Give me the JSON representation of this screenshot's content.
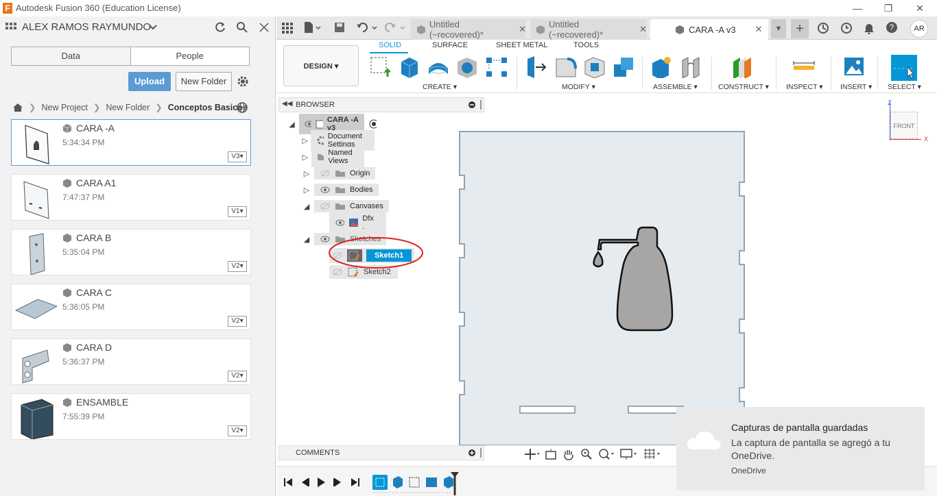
{
  "window": {
    "title": "Autodesk Fusion 360 (Education License)"
  },
  "left_panel": {
    "user": "ALEX RAMOS RAYMUNDO",
    "tabs": [
      "Data",
      "People"
    ],
    "upload_label": "Upload",
    "new_folder_label": "New Folder",
    "breadcrumb": [
      "New Project",
      "New Folder",
      "Conceptos Basicos"
    ],
    "files": [
      {
        "name": "CARA -A",
        "time": "5:34:34 PM",
        "version": "V3"
      },
      {
        "name": "CARA A1",
        "time": "7:47:37 PM",
        "version": "V1"
      },
      {
        "name": "CARA B",
        "time": "5:35:04 PM",
        "version": "V2"
      },
      {
        "name": "CARA C",
        "time": "5:36:05 PM",
        "version": "V2"
      },
      {
        "name": "CARA D",
        "time": "5:36:37 PM",
        "version": "V2"
      },
      {
        "name": "ENSAMBLE",
        "time": "7:55:39 PM",
        "version": "V2"
      }
    ]
  },
  "doc_tabs": [
    {
      "label": "Untitled (~recovered)*"
    },
    {
      "label": "Untitled (~recovered)*"
    },
    {
      "label": "CARA -A v3"
    }
  ],
  "user_initials": "AR",
  "toolbar": {
    "workspace": "DESIGN",
    "tabs": [
      "SOLID",
      "SURFACE",
      "SHEET METAL",
      "TOOLS"
    ],
    "groups": [
      "CREATE",
      "MODIFY",
      "ASSEMBLE",
      "CONSTRUCT",
      "INSPECT",
      "INSERT",
      "SELECT"
    ]
  },
  "browser": {
    "label": "BROWSER",
    "root": "CARA -A v3",
    "nodes": [
      "Document Settings",
      "Named Views",
      "Origin",
      "Bodies",
      "Canvases",
      "Dfx .",
      "Sketches",
      "Sketch1",
      "Sketch2"
    ]
  },
  "viewcube": {
    "label": "FRONT",
    "axis_z": "Z",
    "axis_x": "X"
  },
  "comments": {
    "label": "COMMENTS"
  },
  "toast": {
    "title": "Capturas de pantalla guardadas",
    "message": "La captura de pantalla se agregó a tu OneDrive.",
    "source": "OneDrive"
  },
  "colors": {
    "accent": "#0696d7",
    "upload": "#5b9bd5",
    "highlight": "#e0201b"
  }
}
